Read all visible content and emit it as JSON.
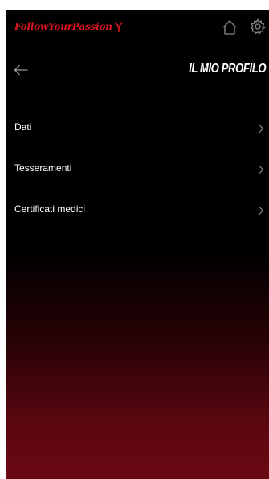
{
  "header": {
    "logo_text": "FollowYourPassion",
    "home_icon": "home-icon",
    "settings_icon": "gear-icon"
  },
  "nav": {
    "back_icon": "back-arrow-icon",
    "title": "IL MIO PROFILO"
  },
  "menu": {
    "items": [
      {
        "label": "Dati",
        "icon": "chevron-right-icon"
      },
      {
        "label": "Tesseramenti",
        "icon": "chevron-right-icon"
      },
      {
        "label": "Certificati medici",
        "icon": "chevron-right-icon"
      }
    ]
  },
  "colors": {
    "brand_red": "#e0141e",
    "background_top": "#000000",
    "background_bottom": "#6b0812",
    "divider": "#bdbdbd",
    "text": "#ffffff"
  }
}
